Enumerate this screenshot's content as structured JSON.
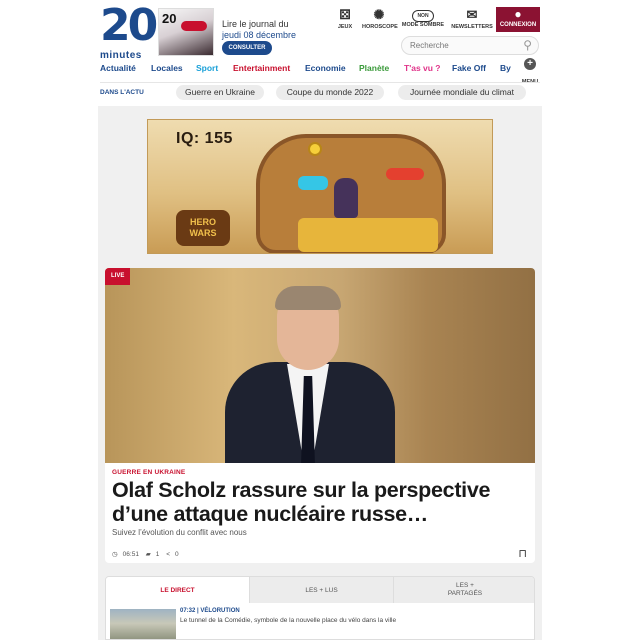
{
  "brand": {
    "number": "20",
    "word": "minutes"
  },
  "journal": {
    "line1": "Lire le journal du",
    "date": "jeudi 08 décembre",
    "button": "CONSULTER"
  },
  "top_icons": [
    {
      "label": "JEUX",
      "icon": "dice-icon"
    },
    {
      "label": "HOROSCOPE",
      "icon": "zodiac-wheel-icon"
    },
    {
      "label": "MODE SOMBRE",
      "icon": "toggle-icon",
      "toggle_text": "NON"
    },
    {
      "label": "NEWSLETTERS",
      "icon": "envelope-icon"
    },
    {
      "label": "CONNEXION",
      "icon": "user-icon"
    }
  ],
  "search": {
    "placeholder": "Recherche"
  },
  "nav": [
    {
      "label": "Actualité",
      "color": "#1d4a8c"
    },
    {
      "label": "Locales",
      "color": "#1d4a8c"
    },
    {
      "label": "Sport",
      "color": "#1aa0d8"
    },
    {
      "label": "Entertainment",
      "color": "#c8102e"
    },
    {
      "label": "Economie",
      "color": "#1d4a8c"
    },
    {
      "label": "Planète",
      "color": "#3a9a3a"
    },
    {
      "label": "T'as vu ?",
      "color": "#e0348a"
    },
    {
      "label": "Fake Off",
      "color": "#1d4a8c"
    },
    {
      "label": "By t",
      "color": "#1d4a8c"
    }
  ],
  "menu": {
    "plus": "+",
    "label": "MENU"
  },
  "actu": {
    "label": "DANS L'ACTU",
    "pills": [
      "Guerre en Ukraine",
      "Coupe du monde 2022",
      "Journée mondiale du climat"
    ]
  },
  "ad": {
    "iq": "IQ: 155",
    "brand": "HERO WARS"
  },
  "main_article": {
    "badge": "LIVE",
    "kicker": "GUERRE EN UKRAINE",
    "headline": "Olaf Scholz rassure sur la perspective d’une attaque nucléaire russe…",
    "subhead": "Suivez l’évolution du conflit avec nous",
    "time": "06:51",
    "comments": "1",
    "shares": "0"
  },
  "tabs": [
    {
      "label": "LE DIRECT",
      "active": true
    },
    {
      "label": "LES + LUS",
      "active": false
    },
    {
      "label": "LES + PARTAGÉS",
      "active": false
    }
  ],
  "direct_item": {
    "time": "07:32 | VÉLORUTION",
    "text": "Le tunnel de la Comédie, symbole de la nouvelle place du vélo dans la ville"
  }
}
